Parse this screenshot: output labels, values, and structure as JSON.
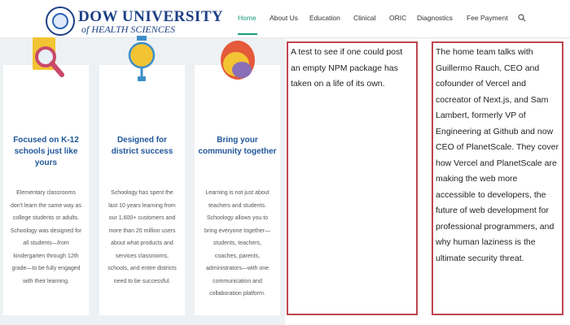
{
  "header": {
    "logo_line1": "DOW UNIVERSITY",
    "logo_line2": "of HEALTH SCIENCES",
    "nav": [
      {
        "label": "Home",
        "active": true
      },
      {
        "label": "About Us"
      },
      {
        "label": "Education"
      },
      {
        "label": "Clinical"
      },
      {
        "label": "ORIC"
      },
      {
        "label": "Diagnostics"
      },
      {
        "label": "Fee Payment"
      }
    ],
    "search_icon": "search-icon",
    "accent_color": "#1a9c7c",
    "brand_color": "#1d3f86"
  },
  "cards": [
    {
      "icon": "magnifier-illustration",
      "title": "Focused on K-12 schools just like yours",
      "description": "Elementary classrooms don't learn the same way as college students or adults. Schoology was designed for all students—from kindergarten through 12th grade—to be fully engaged with their learning."
    },
    {
      "icon": "lightbulb-illustration",
      "title": "Designed for district success",
      "description": "Schoology has spent the last 10 years learning from our 1,600+ customers and more than 20 million users about what products and services classrooms, schools, and entire districts need to be successful."
    },
    {
      "icon": "megaphone-illustration",
      "title": "Bring your community together",
      "description": "Learning is not just about teachers and students. Schoology allows you to bring everyone together—students, teachers, coaches, parents, administrators—with one communication and collaboration platform."
    }
  ],
  "boxes": [
    {
      "text": "A test to see if one could post an empty NPM package has taken on a life of its own."
    },
    {
      "text": "The home team talks with Guillermo Rauch, CEO and cofounder of Vercel and cocreator of Next.js, and Sam Lambert, formerly VP of Engineering at Github and now CEO of PlanetScale. They cover how Vercel and PlanetScale are making the web more accessible to developers, the future of web development for professional programmers, and why human laziness is the ultimate security threat."
    }
  ],
  "colors": {
    "card_title": "#21579a",
    "box_border": "#c0454f"
  }
}
